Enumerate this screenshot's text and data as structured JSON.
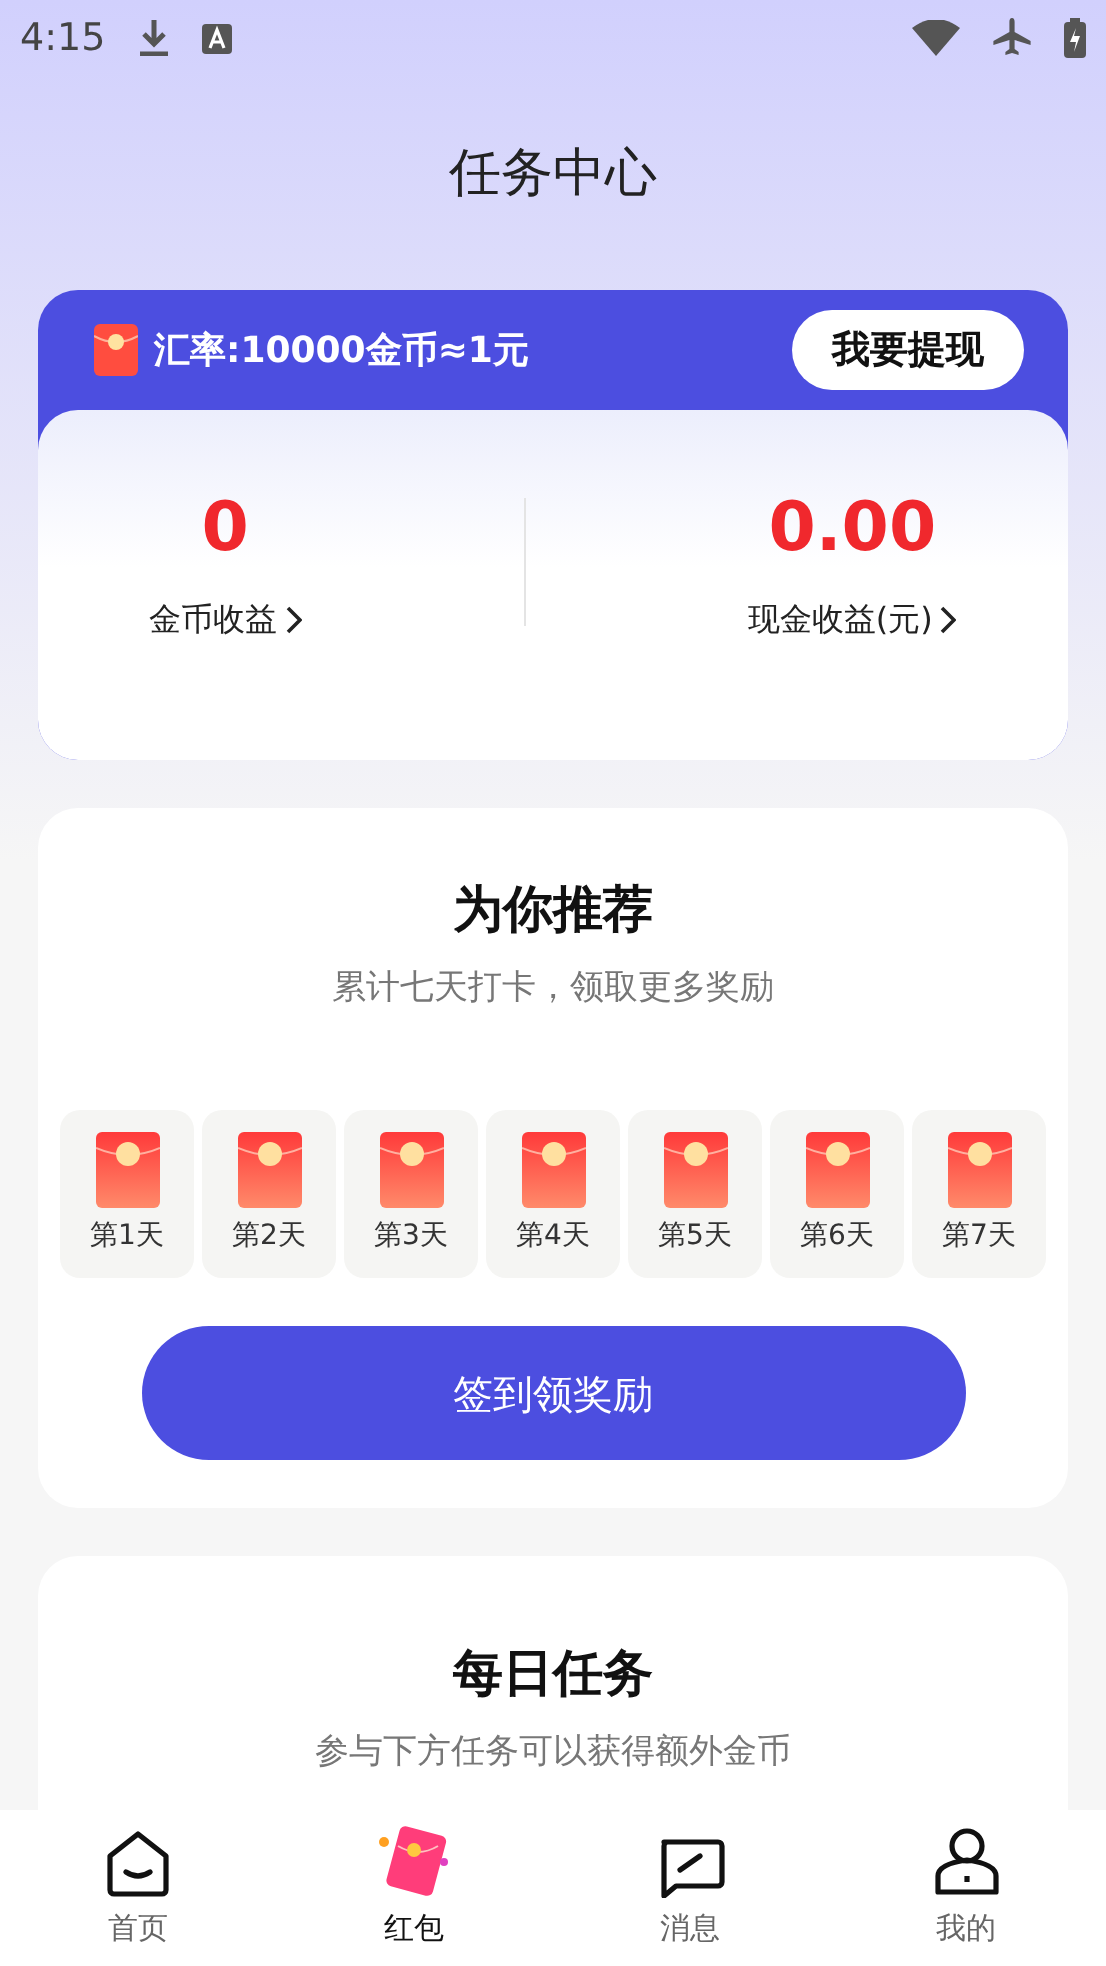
{
  "status_bar": {
    "time": "4:15"
  },
  "title": "任务中心",
  "wallet": {
    "rate": "汇率:10000金币≈1元",
    "withdraw_button": "我要提现",
    "stats": [
      {
        "value": "0",
        "label": "金币收益"
      },
      {
        "value": "0.00",
        "label": "现金收益(元)"
      }
    ]
  },
  "checkin": {
    "title": "为你推荐",
    "subtitle": "累计七天打卡，领取更多奖励",
    "days": [
      {
        "label": "第1天"
      },
      {
        "label": "第2天"
      },
      {
        "label": "第3天"
      },
      {
        "label": "第4天"
      },
      {
        "label": "第5天"
      },
      {
        "label": "第6天"
      },
      {
        "label": "第7天"
      }
    ],
    "button": "签到领奖励"
  },
  "daily_tasks": {
    "title": "每日任务",
    "subtitle": "参与下方任务可以获得额外金币"
  },
  "bottom_nav": [
    {
      "label": "首页",
      "selected": false
    },
    {
      "label": "红包",
      "selected": true
    },
    {
      "label": "消息",
      "selected": false
    },
    {
      "label": "我的",
      "selected": false
    }
  ]
}
